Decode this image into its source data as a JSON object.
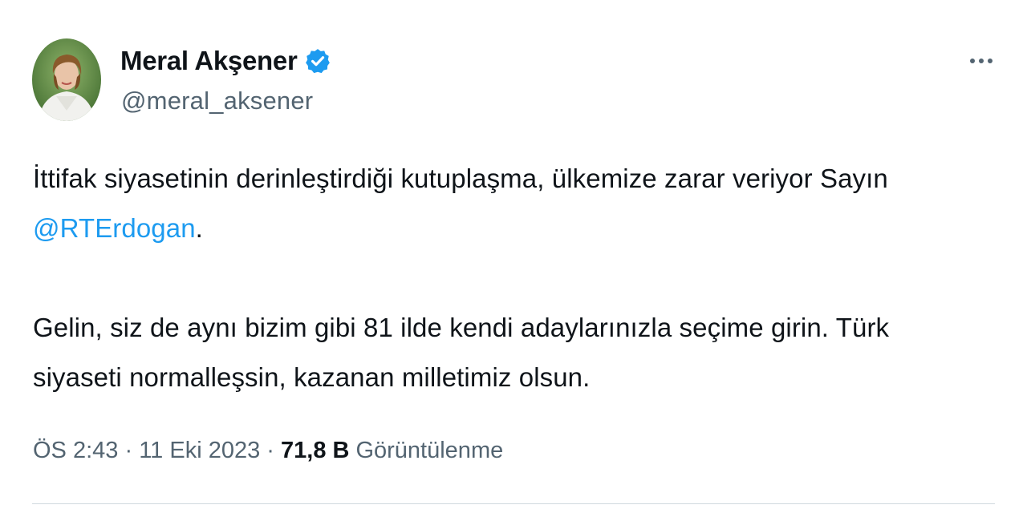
{
  "author": {
    "display_name": "Meral Akşener",
    "handle": "@meral_aksener",
    "avatar_icon": "profile-photo",
    "verified_icon": "verified-badge-icon",
    "verified_color": "#1d9bf0"
  },
  "more_icon": "more-options-icon",
  "tweet": {
    "line1_text": "İttifak siyasetinin derinleştirdiği kutuplaşma, ülkemize zarar veriyor Sayın",
    "mention": "@RTErdogan",
    "mention_suffix": ".",
    "paragraph2_line1": "Gelin, siz de aynı bizim gibi 81 ilde kendi adaylarınızla seçime girin. Türk",
    "paragraph2_line2": "siyaseti normalleşsin, kazanan milletimiz olsun."
  },
  "meta": {
    "time": "ÖS 2:43",
    "separator": " · ",
    "date": "11 Eki 2023",
    "views_count": "71,8 B",
    "views_label": "Görüntülenme"
  },
  "colors": {
    "text": "#0f1419",
    "secondary": "#536471",
    "link": "#1d9bf0",
    "divider": "#cfd9de"
  }
}
